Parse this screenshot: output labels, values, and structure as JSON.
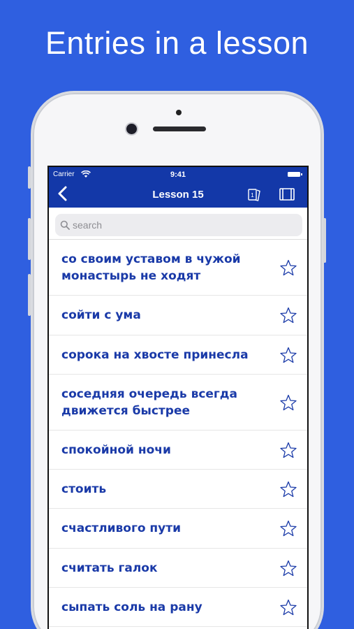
{
  "promo": {
    "title": "Entries in a lesson"
  },
  "status_bar": {
    "carrier": "Carrier",
    "time": "9:41"
  },
  "navbar": {
    "title": "Lesson 15",
    "cards_badge": "1"
  },
  "search": {
    "placeholder": "search"
  },
  "entries": [
    {
      "text": "со своим уставом в чужой монастырь не ходят"
    },
    {
      "text": "сойти с ума"
    },
    {
      "text": "сорока на хвосте принесла"
    },
    {
      "text": "соседняя очередь всегда движется быстрее"
    },
    {
      "text": "спокойной ночи"
    },
    {
      "text": "стоить"
    },
    {
      "text": "счастливого пути"
    },
    {
      "text": "считать галок"
    },
    {
      "text": "сыпать соль на рану"
    }
  ],
  "colors": {
    "background": "#2f5fe0",
    "navbar": "#1338a8",
    "entry_text": "#1a3aa8",
    "star_outline": "#1a3aa8"
  },
  "icons": [
    "back-icon",
    "flashcards-icon",
    "book-icon",
    "search-icon",
    "star-icon",
    "wifi-icon",
    "battery-icon"
  ]
}
